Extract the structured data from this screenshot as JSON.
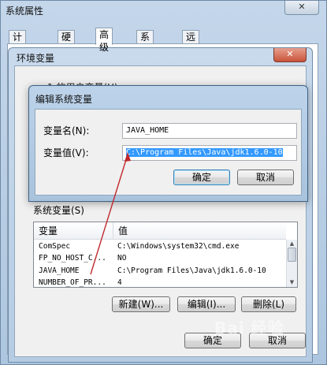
{
  "system_properties": {
    "title": "系统属性",
    "close_glyph": "✕",
    "tabs": [
      {
        "label": "计算机名"
      },
      {
        "label": "硬件"
      },
      {
        "label": "高级"
      },
      {
        "label": "系统保护"
      },
      {
        "label": "远程"
      }
    ],
    "active_tab": "高级"
  },
  "env_vars": {
    "title": "环境变量",
    "close_glyph": "✕",
    "user_vars_label": "1 的用户变量(U)",
    "system_vars_label": "系统变量(S)",
    "table": {
      "columns": [
        "变量",
        "值"
      ],
      "rows": [
        {
          "name": "ComSpec",
          "value": "C:\\Windows\\system32\\cmd.exe"
        },
        {
          "name": "FP_NO_HOST_C...",
          "value": "NO"
        },
        {
          "name": "JAVA_HOME",
          "value": "C:\\Program Files\\Java\\jdk1.6.0-10"
        },
        {
          "name": "NUMBER_OF_PR...",
          "value": "4"
        }
      ]
    },
    "new_button": "新建(W)...",
    "edit_button": "编辑(I)...",
    "delete_button": "删除(L)",
    "ok_button": "确定",
    "cancel_button": "取消"
  },
  "edit_dialog": {
    "title": "编辑系统变量",
    "name_label": "变量名(N):",
    "name_value": "JAVA_HOME",
    "value_label": "变量值(V):",
    "value_value": "C:\\Program Files\\Java\\jdk1.6.0-10",
    "ok_button": "确定",
    "cancel_button": "取消"
  },
  "watermark": "Bai 经验",
  "colors": {
    "selection": "#3399ff",
    "arrow": "#c0282d"
  }
}
